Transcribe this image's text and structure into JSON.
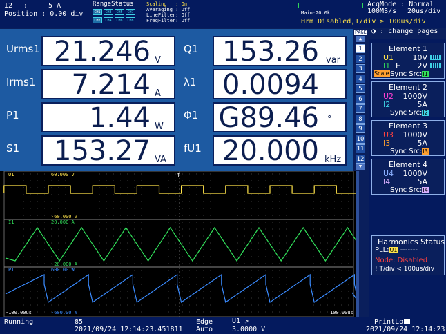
{
  "top": {
    "i2_label": "I2",
    "i2_value": ":     5 A",
    "position": "Position : 0.00 div",
    "range_status_title": "RangeStatus",
    "range_boxes_row1": [
      "CH1",
      "CH3",
      "CH5",
      "CH7"
    ],
    "range_boxes_row2": [
      "CH2",
      "CH4",
      "CH6",
      "CH8"
    ],
    "settings": [
      {
        "label": "Scaling",
        "value": ": On"
      },
      {
        "label": "Averaging",
        "value": ": Off"
      },
      {
        "label": "LineFilter",
        "value": ": Off"
      },
      {
        "label": "FreqFilter",
        "value": ": Off"
      }
    ],
    "main_label": "Main:20.0k",
    "acq_mode": "AcqMode : Normal",
    "sample_rate": "100MS/s",
    "time_div": "20us/div",
    "hrm_text": "Hrm Disabled,T/div ≥ 100us/div"
  },
  "numeric": {
    "rows": [
      {
        "left": {
          "label": "Urms1",
          "value": "21.246",
          "unit": "V"
        },
        "right": {
          "label": "Q1",
          "value": "153.26",
          "unit": "var"
        }
      },
      {
        "left": {
          "label": "Irms1",
          "value": "7.214",
          "unit": "A"
        },
        "right": {
          "label": "λ1",
          "value": "0.0094",
          "unit": ""
        }
      },
      {
        "left": {
          "label": "P1",
          "value": "1.44",
          "unit": "W"
        },
        "right": {
          "label": "Φ1",
          "value": "G89.46",
          "unit": "°"
        }
      },
      {
        "left": {
          "label": "S1",
          "value": "153.27",
          "unit": "VA"
        },
        "right": {
          "label": "fU1",
          "value": "20.000",
          "unit": "kHz"
        }
      }
    ]
  },
  "pages": {
    "title": "PAGE",
    "change_text": ": change pages",
    "numbers": [
      "1",
      "2",
      "3",
      "4",
      "5",
      "6",
      "7",
      "8",
      "9",
      "10",
      "11",
      "12"
    ]
  },
  "elements": [
    {
      "title": "Element 1",
      "u": "U1",
      "u_range": "10V",
      "i": "I1",
      "i_e": "E",
      "i_range": "2V",
      "scale": "Scale",
      "sync": "Sync Src:",
      "sync_src": "I1",
      "u_color": "#ffe34a",
      "i_color": "#31e05a"
    },
    {
      "title": "Element 2",
      "u": "U2",
      "u_range": "1000V",
      "i": "I2",
      "i_range": "5A",
      "sync": "Sync Src:",
      "sync_src": "I2",
      "u_color": "#ff3fd3",
      "i_color": "#3fd3e6"
    },
    {
      "title": "Element 3",
      "u": "U3",
      "u_range": "1000V",
      "i": "I3",
      "i_range": "5A",
      "sync": "Sync Src:",
      "sync_src": "I3",
      "u_color": "#ff4040",
      "i_color": "#ffa030"
    },
    {
      "title": "Element 4",
      "u": "U4",
      "u_range": "1000V",
      "i": "I4",
      "i_range": "5A",
      "sync": "Sync Src:",
      "sync_src": "I4",
      "u_color": "#8ab0ff",
      "i_color": "#d8b0ff"
    }
  ],
  "harmonics": {
    "title": "Harmonics Status",
    "pll_label": "PLL:",
    "pll_src": "U1",
    "pll_dashes": "-------",
    "node_text": "Node: Disabled",
    "note": "! T/div < 100us/div"
  },
  "wave": {
    "ch1_name": "U1",
    "ch1_top": "60.000 V",
    "ch1_bot": "-60.000 V",
    "ch2_name": "I1",
    "ch2_top": "20.000 A",
    "ch2_bot": "-20.000 A",
    "ch3_name": "P1",
    "ch3_top": "600.00 W",
    "ch3_bot": "-600.00 W",
    "t_left": "-100.00us",
    "t_right": "100.00us",
    "colors": {
      "u": "#ffe34a",
      "i": "#31e05a",
      "p": "#3a8bff"
    }
  },
  "status": {
    "state": "Running",
    "count": "85",
    "datetime1": "2021/09/24 12:14:23.451811",
    "trig_mode": "Edge",
    "trig_auto": "Auto",
    "trig_src": "U1",
    "trig_level": "3.0000 V",
    "print": "PrintLo",
    "datetime2": "2021/09/24 12:14:23"
  }
}
